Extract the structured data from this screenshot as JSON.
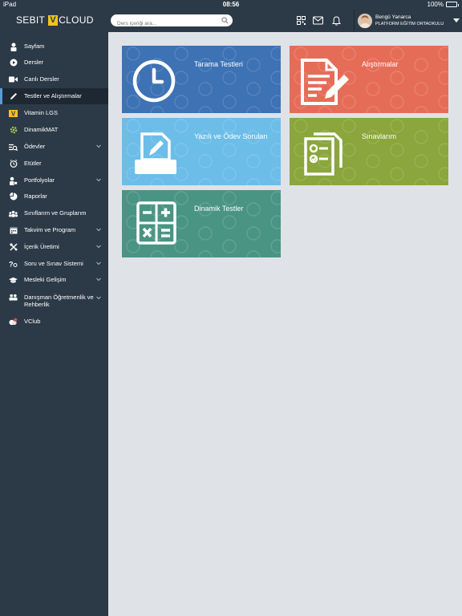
{
  "status_bar": {
    "device": "iPad",
    "time": "08:56",
    "battery": "100%",
    "battery_level": 1.0
  },
  "header": {
    "logo_left": "SEBIT",
    "logo_v": "V",
    "logo_right": "CLOUD",
    "search_placeholder": "Ders içeriği ara...",
    "user_name": "Bengü Yanarca",
    "user_school": "PLATFORM EĞİTİM ORTAOKULU"
  },
  "sidebar": {
    "items": [
      {
        "label": "Sayfam",
        "icon": "home-icon"
      },
      {
        "label": "Dersler",
        "icon": "play-icon"
      },
      {
        "label": "Canlı Dersler",
        "icon": "video-camera-icon"
      },
      {
        "label": "Testler ve Alıştırmalar",
        "icon": "pencil-icon",
        "active": true
      },
      {
        "label": "Vitamin LGS",
        "icon": "vitamin-icon"
      },
      {
        "label": "DinamikMAT",
        "icon": "gear-icon"
      },
      {
        "label": "Ödevler",
        "icon": "homework-icon",
        "has_children": true
      },
      {
        "label": "Etütler",
        "icon": "clock-icon"
      },
      {
        "label": "Portfolyolar",
        "icon": "portfolio-icon",
        "has_children": true
      },
      {
        "label": "Raporlar",
        "icon": "pie-chart-icon"
      },
      {
        "label": "Sınıflarım ve Gruplarım",
        "icon": "group-icon"
      },
      {
        "label": "Takvim ve Program",
        "icon": "calendar-icon",
        "has_children": true
      },
      {
        "label": "İçerik Üretimi",
        "icon": "tools-icon",
        "has_children": true
      },
      {
        "label": "Soru ve Sınav Sistemi",
        "icon": "question-icon",
        "has_children": true
      },
      {
        "label": "Mesleki Gelişim",
        "icon": "graduation-cap-icon",
        "has_children": true
      },
      {
        "label": "Danışman Öğretmenlik ve Rehberlik",
        "icon": "mentor-icon",
        "has_children": true
      },
      {
        "label": "VClub",
        "icon": "vclub-icon"
      }
    ]
  },
  "tiles": [
    {
      "label": "Tarama Testleri",
      "color": "#3d72b4",
      "icon": "clock-icon"
    },
    {
      "label": "Alıştırmalar",
      "color": "#e56d58",
      "icon": "document-edit-icon"
    },
    {
      "label": "Yazılı ve Ödev Soruları",
      "color": "#6cbde8",
      "icon": "printer-pencil-icon"
    },
    {
      "label": "Sınavlarım",
      "color": "#8aa63c",
      "icon": "exam-checklist-icon"
    },
    {
      "label": "Dinamik Testler",
      "color": "#4a9484",
      "icon": "calculator-icon"
    }
  ]
}
